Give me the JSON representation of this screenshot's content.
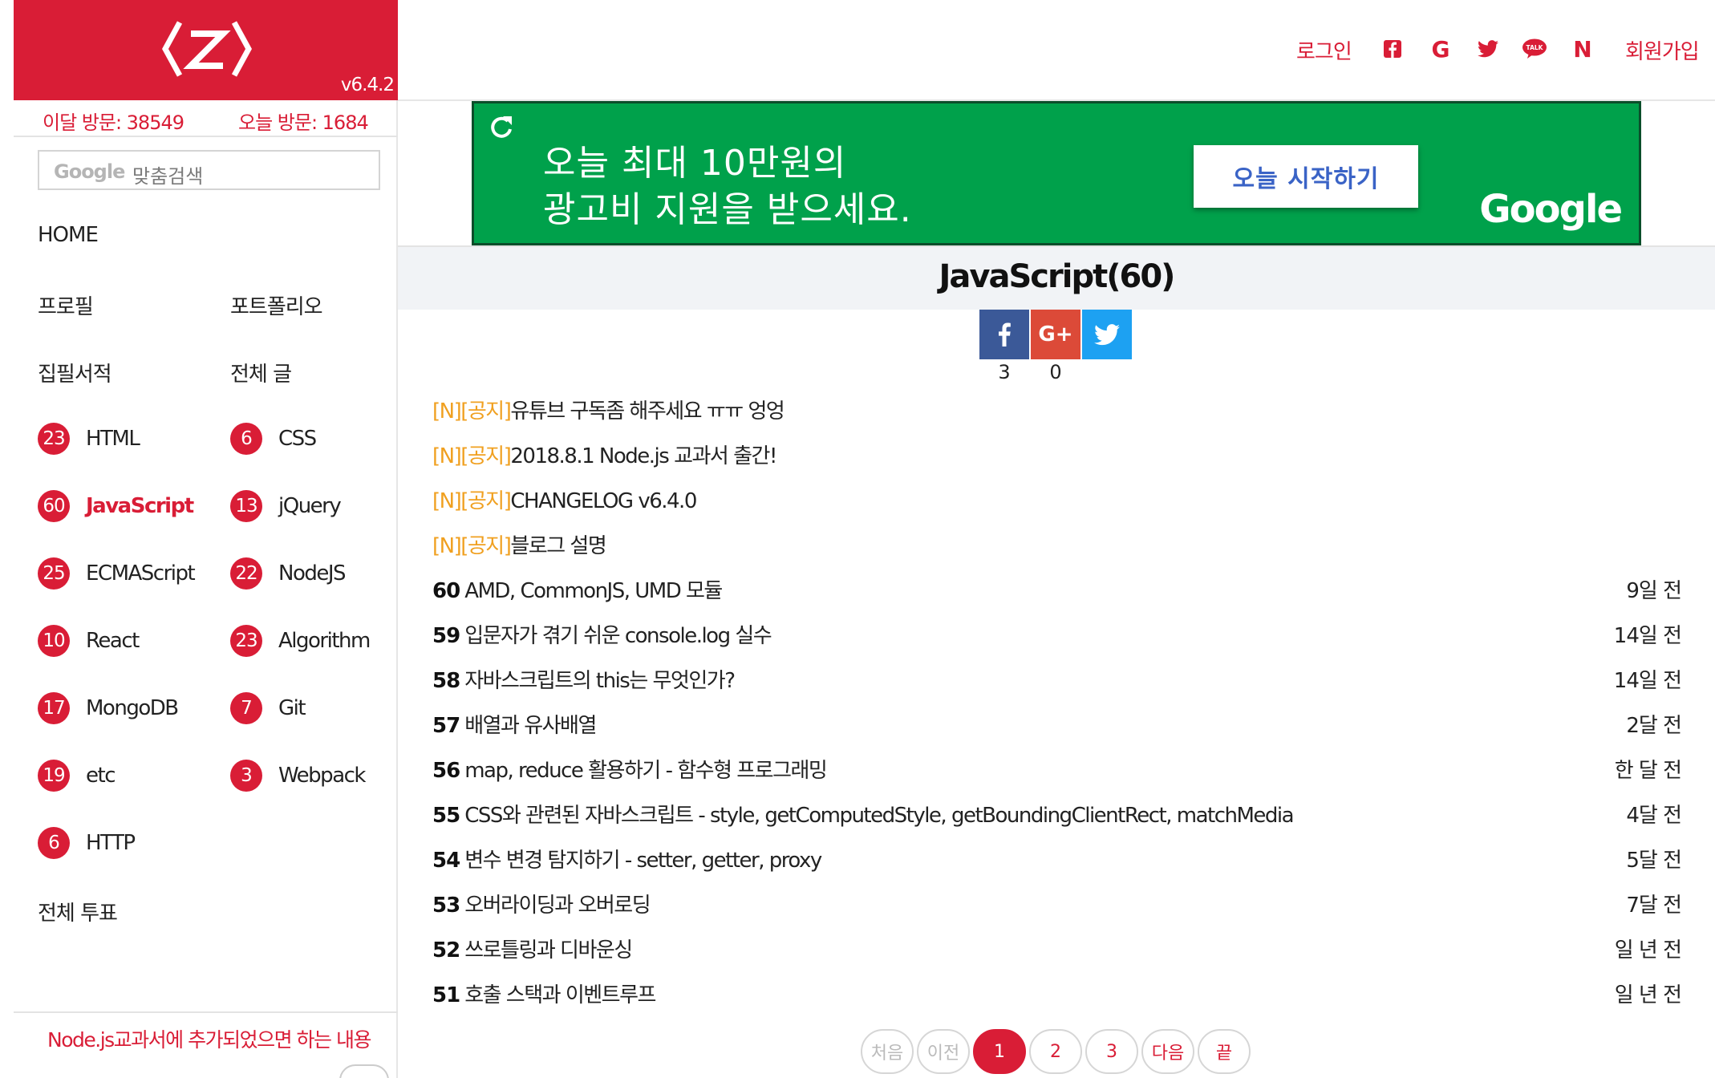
{
  "brand": {
    "logo_text": "Z",
    "version": "v6.4.2"
  },
  "visits": {
    "month": "이달 방문: 38549",
    "today": "오늘 방문: 1684"
  },
  "search": {
    "google_label": "Google",
    "placeholder": "맞춤검색"
  },
  "sidebar": {
    "home": "HOME",
    "profile": "프로필",
    "portfolio": "포트폴리오",
    "books": "집필서적",
    "all_posts": "전체 글",
    "categories": [
      {
        "count": "23",
        "label": "HTML"
      },
      {
        "count": "6",
        "label": "CSS"
      },
      {
        "count": "60",
        "label": "JavaScript",
        "active": true
      },
      {
        "count": "13",
        "label": "jQuery"
      },
      {
        "count": "25",
        "label": "ECMAScript"
      },
      {
        "count": "22",
        "label": "NodeJS"
      },
      {
        "count": "10",
        "label": "React"
      },
      {
        "count": "23",
        "label": "Algorithm"
      },
      {
        "count": "17",
        "label": "MongoDB"
      },
      {
        "count": "7",
        "label": "Git"
      },
      {
        "count": "19",
        "label": "etc"
      },
      {
        "count": "3",
        "label": "Webpack"
      },
      {
        "count": "6",
        "label": "HTTP"
      }
    ],
    "all_votes": "전체 투표",
    "bottom_link": "Node.js교과서에 추가되었으면 하는 내용"
  },
  "header": {
    "login": "로그인",
    "signup": "회원가입",
    "icons": [
      "facebook-icon",
      "google-icon",
      "twitter-icon",
      "kakaotalk-icon",
      "naver-icon"
    ],
    "kakao_text": "TALK",
    "naver_text": "N",
    "google_text": "G"
  },
  "ad": {
    "line1": "오늘 최대 10만원의",
    "line2": "광고비 지원을 받으세요.",
    "button": "오늘 시작하기",
    "brand": "Google"
  },
  "page": {
    "title": "JavaScript(60)",
    "share_counts": {
      "facebook": "3",
      "google": "0"
    }
  },
  "notices": [
    {
      "tag": "[N][공지]",
      "title": "유튜브 구독좀 해주세요 ㅠㅠ 엉엉"
    },
    {
      "tag": "[N][공지]",
      "title": "2018.8.1 Node.js 교과서 출간!"
    },
    {
      "tag": "[N][공지]",
      "title": "CHANGELOG v6.4.0"
    },
    {
      "tag": "[N][공지]",
      "title": "블로그 설명"
    }
  ],
  "posts": [
    {
      "num": "60",
      "title": "AMD, CommonJS, UMD 모듈",
      "date": "9일 전"
    },
    {
      "num": "59",
      "title": "입문자가 겪기 쉬운 console.log 실수",
      "date": "14일 전"
    },
    {
      "num": "58",
      "title": "자바스크립트의 this는 무엇인가?",
      "date": "14일 전"
    },
    {
      "num": "57",
      "title": "배열과 유사배열",
      "date": "2달 전"
    },
    {
      "num": "56",
      "title": "map, reduce 활용하기 - 함수형 프로그래밍",
      "date": "한 달 전"
    },
    {
      "num": "55",
      "title": "CSS와 관련된 자바스크립트 - style, getComputedStyle, getBoundingClientRect, matchMedia",
      "date": "4달 전"
    },
    {
      "num": "54",
      "title": "변수 변경 탐지하기 - setter, getter, proxy",
      "date": "5달 전"
    },
    {
      "num": "53",
      "title": "오버라이딩과 오버로딩",
      "date": "7달 전"
    },
    {
      "num": "52",
      "title": "쓰로틀링과 디바운싱",
      "date": "일 년 전"
    },
    {
      "num": "51",
      "title": "호출 스택과 이벤트루프",
      "date": "일 년 전"
    }
  ],
  "pagination": {
    "first": "처음",
    "prev": "이전",
    "pages": [
      "1",
      "2",
      "3"
    ],
    "current": "1",
    "next": "다음",
    "last": "끝"
  },
  "colors": {
    "accent": "#d91d36",
    "notice_tag": "#f0a020",
    "ad_green": "#00a14b"
  }
}
